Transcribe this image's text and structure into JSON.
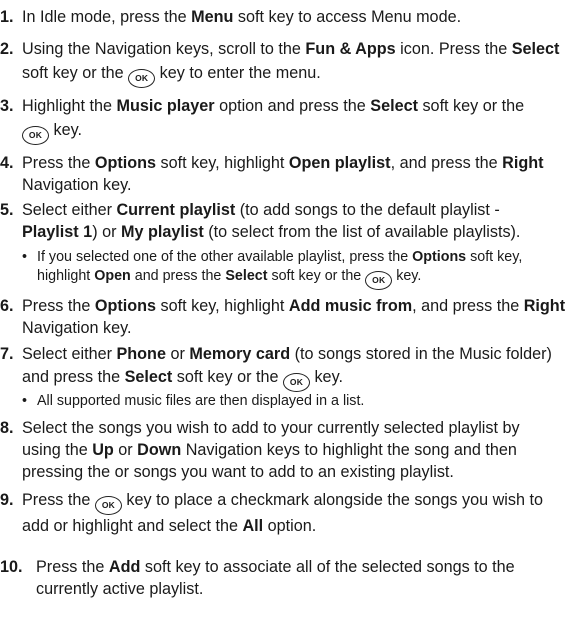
{
  "ok_key_label": "OK",
  "bullet": "•",
  "steps": [
    {
      "num": "1.",
      "parts": [
        "In Idle mode, press the ",
        "Menu",
        " soft key to access Menu mode."
      ]
    },
    {
      "num": "2.",
      "line1": [
        "Using the Navigation keys, scroll to the ",
        "Fun & Apps",
        " icon. Press the ",
        "Select"
      ],
      "line2": [
        "soft key or the ",
        " key to enter the menu."
      ]
    },
    {
      "num": "3.",
      "line1": [
        "Highlight the ",
        "Music player",
        " option and press the ",
        "Select",
        " soft key or the"
      ],
      "line2": [
        " key."
      ]
    },
    {
      "num": "4.",
      "line1": [
        "Press the ",
        "Options",
        " soft key, highlight ",
        "Open playlist",
        ", and press the ",
        "Right"
      ],
      "line2": [
        "Navigation key."
      ]
    },
    {
      "num": "5.",
      "line1": [
        "Select either ",
        "Current playlist",
        " (to add songs to the default playlist -"
      ],
      "line2": [
        "Playlist 1",
        ") or ",
        "My playlist",
        " (to select from the list of available playlists)."
      ]
    },
    {
      "num": "6.",
      "line1": [
        "Press the ",
        "Options",
        " soft key, highlight ",
        "Add music from",
        ", and press the ",
        "Right"
      ],
      "line2": [
        "Navigation key."
      ]
    },
    {
      "num": "7.",
      "line1": [
        "Select either ",
        "Phone",
        " or ",
        "Memory card",
        " (to songs stored in the Music folder)"
      ],
      "line2": [
        "and press the ",
        "Select",
        " soft key or the ",
        " key."
      ]
    },
    {
      "num": "8.",
      "line1": [
        "Select the songs you wish to add to your currently selected playlist by"
      ],
      "line2": [
        "using the ",
        "Up",
        " or ",
        "Down",
        " Navigation keys to highlight the song and then"
      ],
      "line3": [
        "pressing the or songs you want to add to an existing playlist."
      ]
    },
    {
      "num": "9.",
      "line1": [
        "Press the ",
        " key to place a checkmark alongside the songs you wish to"
      ],
      "line2": [
        "add or highlight and select the ",
        "All",
        " option."
      ]
    },
    {
      "num": "10.",
      "line1": [
        "Press the ",
        "Add",
        " soft key to associate all of the selected songs to the"
      ],
      "line2": [
        "currently active playlist."
      ]
    }
  ],
  "sub5": {
    "line1": [
      "If you selected one of the other available playlist, press the ",
      "Options",
      " soft key,"
    ],
    "line2": [
      "highlight ",
      "Open",
      " and press the ",
      "Select",
      " soft key or the ",
      " key."
    ]
  },
  "sub7": {
    "text": "All supported music files are then displayed in a list."
  }
}
